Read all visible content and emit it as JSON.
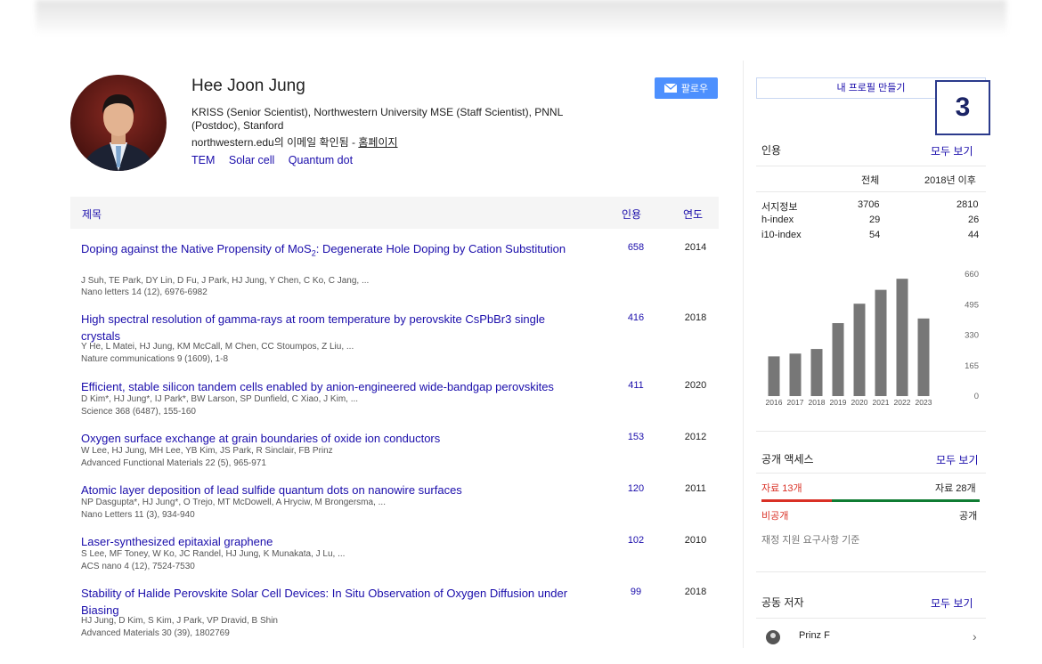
{
  "profile": {
    "name": "Hee Joon Jung",
    "affiliation": "KRISS (Senior Scientist), Northwestern University MSE (Staff Scientist), PNNL (Postdoc), Stanford",
    "email_verified": "northwestern.edu의 이메일 확인됨",
    "separator": " - ",
    "homepage": "홈페이지",
    "interests": [
      "TEM",
      "Solar cell",
      "Quantum dot"
    ],
    "follow_label": "팔로우",
    "follow_icon": "envelope-icon"
  },
  "table": {
    "headers": {
      "title": "제목",
      "cites": "인용",
      "year": "연도"
    },
    "rows": [
      {
        "title_pre": "Doping against the Native Propensity of MoS",
        "title_sub": "2",
        "title_post": ": Degenerate Hole Doping by Cation Substitution",
        "authors": "J Suh, TE Park, DY Lin, D Fu, J Park, HJ Jung, Y Chen, C Ko, C Jang, ...",
        "venue": "Nano letters 14 (12), 6976-6982",
        "cites": "658",
        "year": "2014"
      },
      {
        "title_pre": "High spectral resolution of gamma-rays at room temperature by perovskite CsPbBr3 single crystals",
        "title_sub": "",
        "title_post": "",
        "authors": "Y He, L Matei, HJ Jung, KM McCall, M Chen, CC Stoumpos, Z Liu, ...",
        "venue": "Nature communications 9 (1609), 1-8",
        "cites": "416",
        "year": "2018"
      },
      {
        "title_pre": "Efficient, stable silicon tandem cells enabled by anion-engineered wide-bandgap perovskites",
        "title_sub": "",
        "title_post": "",
        "authors": "D Kim*, HJ Jung*, IJ Park*, BW Larson, SP Dunfield, C Xiao, J Kim, ...",
        "venue": "Science 368 (6487), 155-160",
        "cites": "411",
        "year": "2020"
      },
      {
        "title_pre": "Oxygen surface exchange at grain boundaries of oxide ion conductors",
        "title_sub": "",
        "title_post": "",
        "authors": "W Lee, HJ Jung, MH Lee, YB Kim, JS Park, R Sinclair, FB Prinz",
        "venue": "Advanced Functional Materials 22 (5), 965-971",
        "cites": "153",
        "year": "2012"
      },
      {
        "title_pre": "Atomic layer deposition of lead sulfide quantum dots on nanowire surfaces",
        "title_sub": "",
        "title_post": "",
        "authors": "NP Dasgupta*, HJ Jung*, O Trejo, MT McDowell, A Hryciw, M Brongersma, ...",
        "venue": "Nano Letters 11 (3), 934-940",
        "cites": "120",
        "year": "2011"
      },
      {
        "title_pre": "Laser-synthesized epitaxial graphene",
        "title_sub": "",
        "title_post": "",
        "authors": "S Lee, MF Toney, W Ko, JC Randel, HJ Jung, K Munakata, J Lu, ...",
        "venue": "ACS nano 4 (12), 7524-7530",
        "cites": "102",
        "year": "2010"
      },
      {
        "title_pre": "Stability of Halide Perovskite Solar Cell Devices: In Situ Observation of Oxygen Diffusion under Biasing",
        "title_sub": "",
        "title_post": "",
        "authors": "HJ Jung, D Kim, S Kim, J Park, VP Dravid, B Shin",
        "venue": "Advanced Materials 30 (39), 1802769",
        "cites": "99",
        "year": "2018"
      }
    ]
  },
  "sidebar": {
    "create_profile": "내 프로필 만들기",
    "badge": "3",
    "citations": {
      "title": "인용",
      "see_all": "모두 보기",
      "col_all": "전체",
      "col_since": "2018년 이후",
      "rows": [
        {
          "label": "서지정보",
          "all": "3706",
          "since": "2810"
        },
        {
          "label": "h-index",
          "all": "29",
          "since": "26"
        },
        {
          "label": "i10-index",
          "all": "54",
          "since": "44"
        }
      ]
    },
    "open_access": {
      "title": "공개 액세스",
      "see_all": "모두 보기",
      "unavailable": "자료 13개",
      "available": "자료 28개",
      "not_public": "비공개",
      "public": "공개",
      "note": "재정 지원 요구사항 기준",
      "unavailable_fraction": 0.317
    },
    "coauthors": {
      "title": "공동 저자",
      "see_all": "모두 보기",
      "first_name": "Prinz F"
    }
  },
  "colors": {
    "link": "#1a0dab",
    "button": "#4d90fe",
    "bar": "#777777",
    "oa_red": "#d93025",
    "oa_green": "#0f7c33"
  },
  "chart_data": {
    "type": "bar",
    "categories": [
      "2016",
      "2017",
      "2018",
      "2019",
      "2020",
      "2021",
      "2022",
      "2023"
    ],
    "values": [
      215,
      230,
      255,
      395,
      500,
      575,
      635,
      420
    ],
    "y_ticks": [
      "660",
      "495",
      "330",
      "165",
      "0"
    ],
    "ylim": [
      0,
      660
    ],
    "grid": false
  }
}
